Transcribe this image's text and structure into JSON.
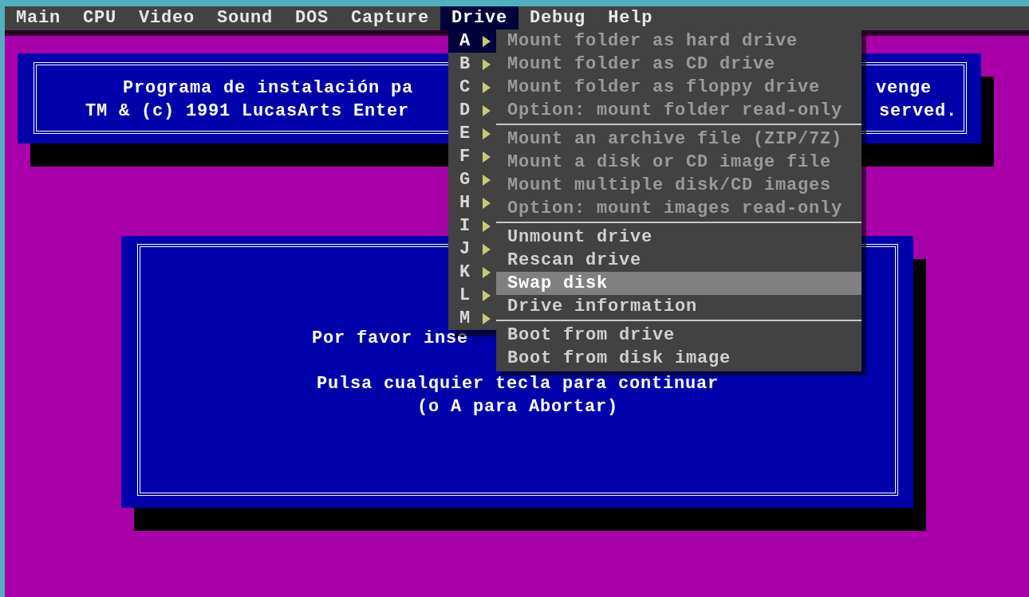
{
  "menu_bar": [
    {
      "label": "Main",
      "selected": false
    },
    {
      "label": "CPU",
      "selected": false
    },
    {
      "label": "Video",
      "selected": false
    },
    {
      "label": "Sound",
      "selected": false
    },
    {
      "label": "DOS",
      "selected": false
    },
    {
      "label": "Capture",
      "selected": false
    },
    {
      "label": "Drive",
      "selected": true
    },
    {
      "label": "Debug",
      "selected": false
    },
    {
      "label": "Help",
      "selected": false
    }
  ],
  "drive_letters": [
    {
      "label": "A",
      "selected": true
    },
    {
      "label": "B",
      "selected": false
    },
    {
      "label": "C",
      "selected": false
    },
    {
      "label": "D",
      "selected": false
    },
    {
      "label": "E",
      "selected": false
    },
    {
      "label": "F",
      "selected": false
    },
    {
      "label": "G",
      "selected": false
    },
    {
      "label": "H",
      "selected": false
    },
    {
      "label": "I",
      "selected": false
    },
    {
      "label": "J",
      "selected": false
    },
    {
      "label": "K",
      "selected": false
    },
    {
      "label": "L",
      "selected": false
    },
    {
      "label": "M",
      "selected": false
    }
  ],
  "drive_menu": [
    {
      "items": [
        {
          "label": "Mount folder as hard drive",
          "disabled": true,
          "selected": false
        },
        {
          "label": "Mount folder as CD drive",
          "disabled": true,
          "selected": false
        },
        {
          "label": "Mount folder as floppy drive",
          "disabled": true,
          "selected": false
        },
        {
          "label": "Option: mount folder read-only",
          "disabled": true,
          "selected": false
        }
      ]
    },
    {
      "items": [
        {
          "label": "Mount an archive file (ZIP/7Z)",
          "disabled": true,
          "selected": false
        },
        {
          "label": "Mount a disk or CD image file",
          "disabled": true,
          "selected": false
        },
        {
          "label": "Mount multiple disk/CD images",
          "disabled": true,
          "selected": false
        },
        {
          "label": "Option: mount images read-only",
          "disabled": true,
          "selected": false
        }
      ]
    },
    {
      "items": [
        {
          "label": "Unmount drive",
          "disabled": false,
          "selected": false
        },
        {
          "label": "Rescan drive",
          "disabled": false,
          "selected": false
        },
        {
          "label": "Swap disk",
          "disabled": false,
          "selected": true
        },
        {
          "label": "Drive information",
          "disabled": false,
          "selected": false
        }
      ]
    },
    {
      "items": [
        {
          "label": "Boot from drive",
          "disabled": false,
          "selected": false
        },
        {
          "label": "Boot from disk image",
          "disabled": false,
          "selected": false
        }
      ]
    }
  ],
  "title_box": {
    "lines": [
      {
        "left": "Programa de instalación pa",
        "right": "venge"
      },
      {
        "left": "TM & (c) 1991 LucasArts Enter",
        "right": "served."
      }
    ]
  },
  "message_box": {
    "partial": "Por favor inse",
    "lines": [
      "Pulsa cualquier tecla para continuar",
      "(o A para Abortar)"
    ]
  }
}
